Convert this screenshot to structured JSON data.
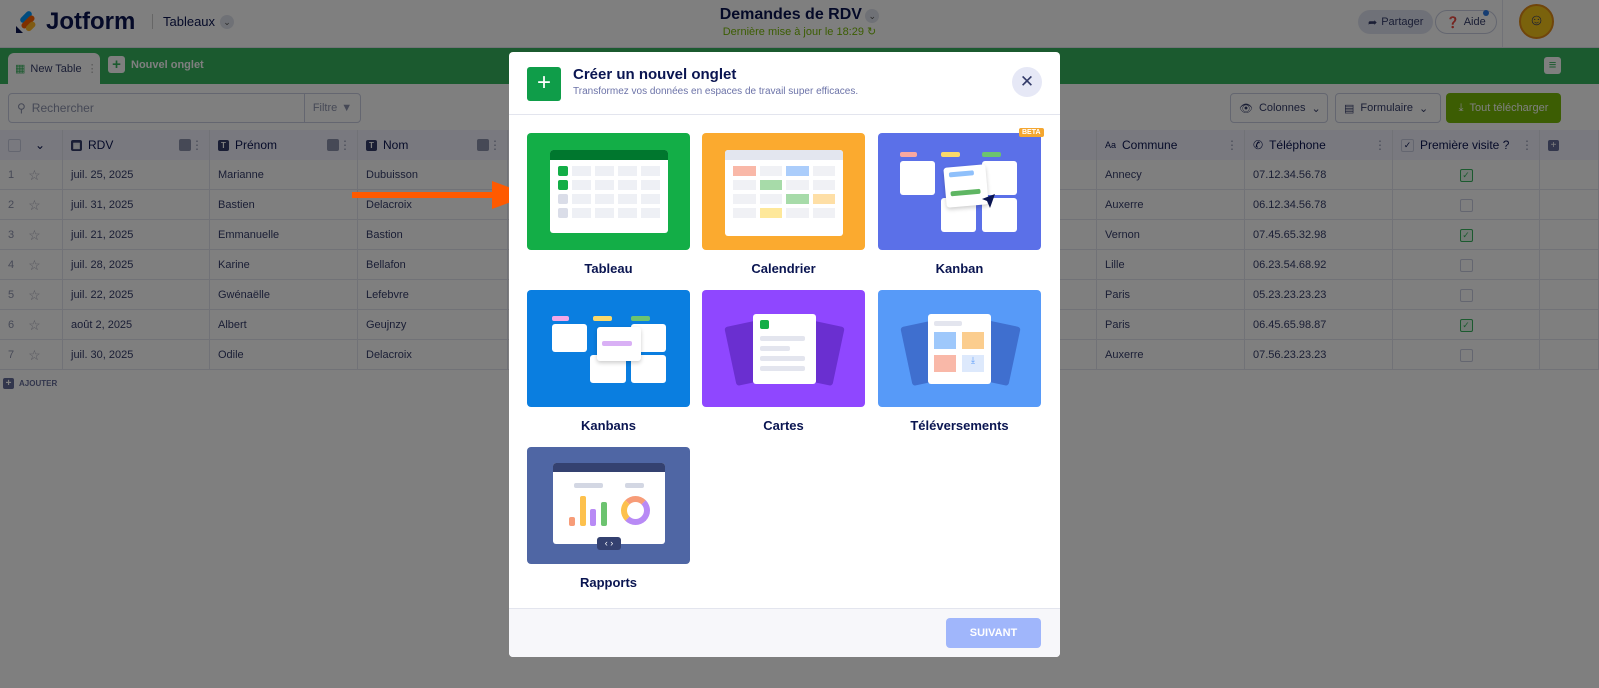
{
  "header": {
    "brand": "Jotform",
    "product": "Tableaux",
    "title": "Demandes de RDV",
    "subtitle": "Dernière mise à jour le 18:29",
    "share": "Partager",
    "help": "Aide"
  },
  "tabs": {
    "active": "New Table",
    "new_tab": "Nouvel onglet"
  },
  "toolbar": {
    "search_placeholder": "Rechercher",
    "filter": "Filtre",
    "columns": "Colonnes",
    "form": "Formulaire",
    "download": "Tout télécharger"
  },
  "table": {
    "columns": [
      "RDV",
      "Prénom",
      "Nom",
      "Commune",
      "Téléphone",
      "Première visite ?"
    ],
    "rows": [
      {
        "n": "1",
        "rdv": "juil. 25, 2025",
        "prenom": "Marianne",
        "nom": "Dubuisson",
        "commune": "Annecy",
        "tel": "07.12.34.56.78",
        "visite": true
      },
      {
        "n": "2",
        "rdv": "juil. 31, 2025",
        "prenom": "Bastien",
        "nom": "Delacroix",
        "commune": "Auxerre",
        "tel": "06.12.34.56.78",
        "visite": false
      },
      {
        "n": "3",
        "rdv": "juil. 21, 2025",
        "prenom": "Emmanuelle",
        "nom": "Bastion",
        "commune": "Vernon",
        "tel": "07.45.65.32.98",
        "visite": true
      },
      {
        "n": "4",
        "rdv": "juil. 28, 2025",
        "prenom": "Karine",
        "nom": "Bellafon",
        "commune": "Lille",
        "tel": "06.23.54.68.92",
        "visite": false
      },
      {
        "n": "5",
        "rdv": "juil. 22, 2025",
        "prenom": "Gwénaëlle",
        "nom": "Lefebvre",
        "commune": "Paris",
        "tel": "05.23.23.23.23",
        "visite": false
      },
      {
        "n": "6",
        "rdv": "août 2, 2025",
        "prenom": "Albert",
        "nom": "Geujnzy",
        "commune": "Paris",
        "tel": "06.45.65.98.87",
        "visite": true
      },
      {
        "n": "7",
        "rdv": "juil. 30, 2025",
        "prenom": "Odile",
        "nom": "Delacroix",
        "commune": "Auxerre",
        "tel": "07.56.23.23.23",
        "visite": false
      }
    ],
    "add": "AJOUTER"
  },
  "modal": {
    "title": "Créer un nouvel onglet",
    "subtitle": "Transformez vos données en espaces de travail super efficaces.",
    "options": [
      {
        "label": "Tableau",
        "color": "#13ae47"
      },
      {
        "label": "Calendrier",
        "color": "#fbaa2f"
      },
      {
        "label": "Kanban",
        "color": "#5b70e8",
        "badge": "BETA"
      },
      {
        "label": "Kanbans",
        "color": "#0a7ee0"
      },
      {
        "label": "Cartes",
        "color": "#8f47ff"
      },
      {
        "label": "Téléversements",
        "color": "#579af8"
      },
      {
        "label": "Rapports",
        "color": "#4f66a4"
      }
    ],
    "next": "SUIVANT"
  }
}
